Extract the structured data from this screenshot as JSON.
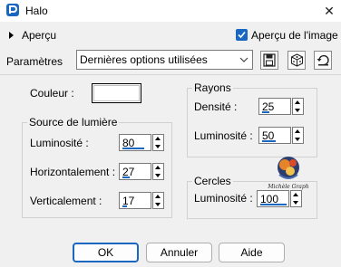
{
  "window": {
    "title": "Halo"
  },
  "preview": {
    "expander_label": "Aperçu",
    "checkbox_label": "Aperçu de l'image",
    "checked": true
  },
  "parameters": {
    "label": "Paramètres",
    "preset_value": "Dernières options utilisées"
  },
  "color": {
    "label": "Couleur :",
    "value": "#ffffff"
  },
  "light_source": {
    "title": "Source de lumière",
    "fields": [
      {
        "label": "Luminosité :",
        "value": "80",
        "level_percent": 80
      },
      {
        "label": "Horizontalement :",
        "value": "27",
        "level_percent": 27
      },
      {
        "label": "Verticalement :",
        "value": "17",
        "level_percent": 17
      }
    ]
  },
  "rays": {
    "title": "Rayons",
    "fields": [
      {
        "label": "Densité :",
        "value": "25",
        "level_percent": 25
      },
      {
        "label": "Luminosité :",
        "value": "50",
        "level_percent": 50
      }
    ]
  },
  "circles": {
    "title": "Cercles",
    "fields": [
      {
        "label": "Luminosité :",
        "value": "100",
        "level_percent": 100
      }
    ]
  },
  "buttons": {
    "ok": "OK",
    "cancel": "Annuler",
    "help": "Aide"
  },
  "watermark": {
    "text": "Michèle Graph"
  },
  "colors": {
    "accent": "#1967c0",
    "background": "#f0f0f0"
  }
}
